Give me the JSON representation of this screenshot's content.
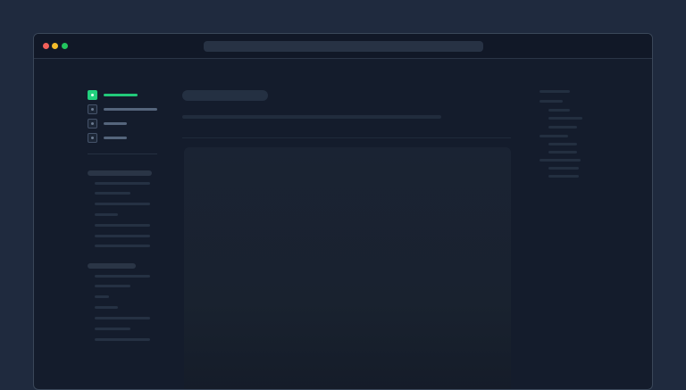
{
  "window": {
    "traffic_lights": [
      "close",
      "minimize",
      "zoom"
    ],
    "colors": {
      "close": "#f4605a",
      "minimize": "#f5bd2b",
      "zoom": "#22c55e"
    },
    "address_bar": ""
  },
  "sidebar": {
    "accent_color": "#22d07e",
    "nav_items": [
      {
        "label": "",
        "active": true
      },
      {
        "label": "",
        "active": false
      },
      {
        "label": "",
        "active": false
      },
      {
        "label": "",
        "active": false
      }
    ],
    "sections": [
      {
        "heading": "",
        "items": [
          "",
          "",
          "",
          "",
          "",
          "",
          ""
        ]
      },
      {
        "heading": "",
        "items": [
          "",
          "",
          "",
          "",
          "",
          "",
          ""
        ]
      }
    ]
  },
  "main": {
    "title": "",
    "subtitle": "",
    "card": ""
  },
  "toc": {
    "items": [
      "",
      "",
      "",
      "",
      "",
      "",
      "",
      "",
      "",
      "",
      ""
    ]
  }
}
